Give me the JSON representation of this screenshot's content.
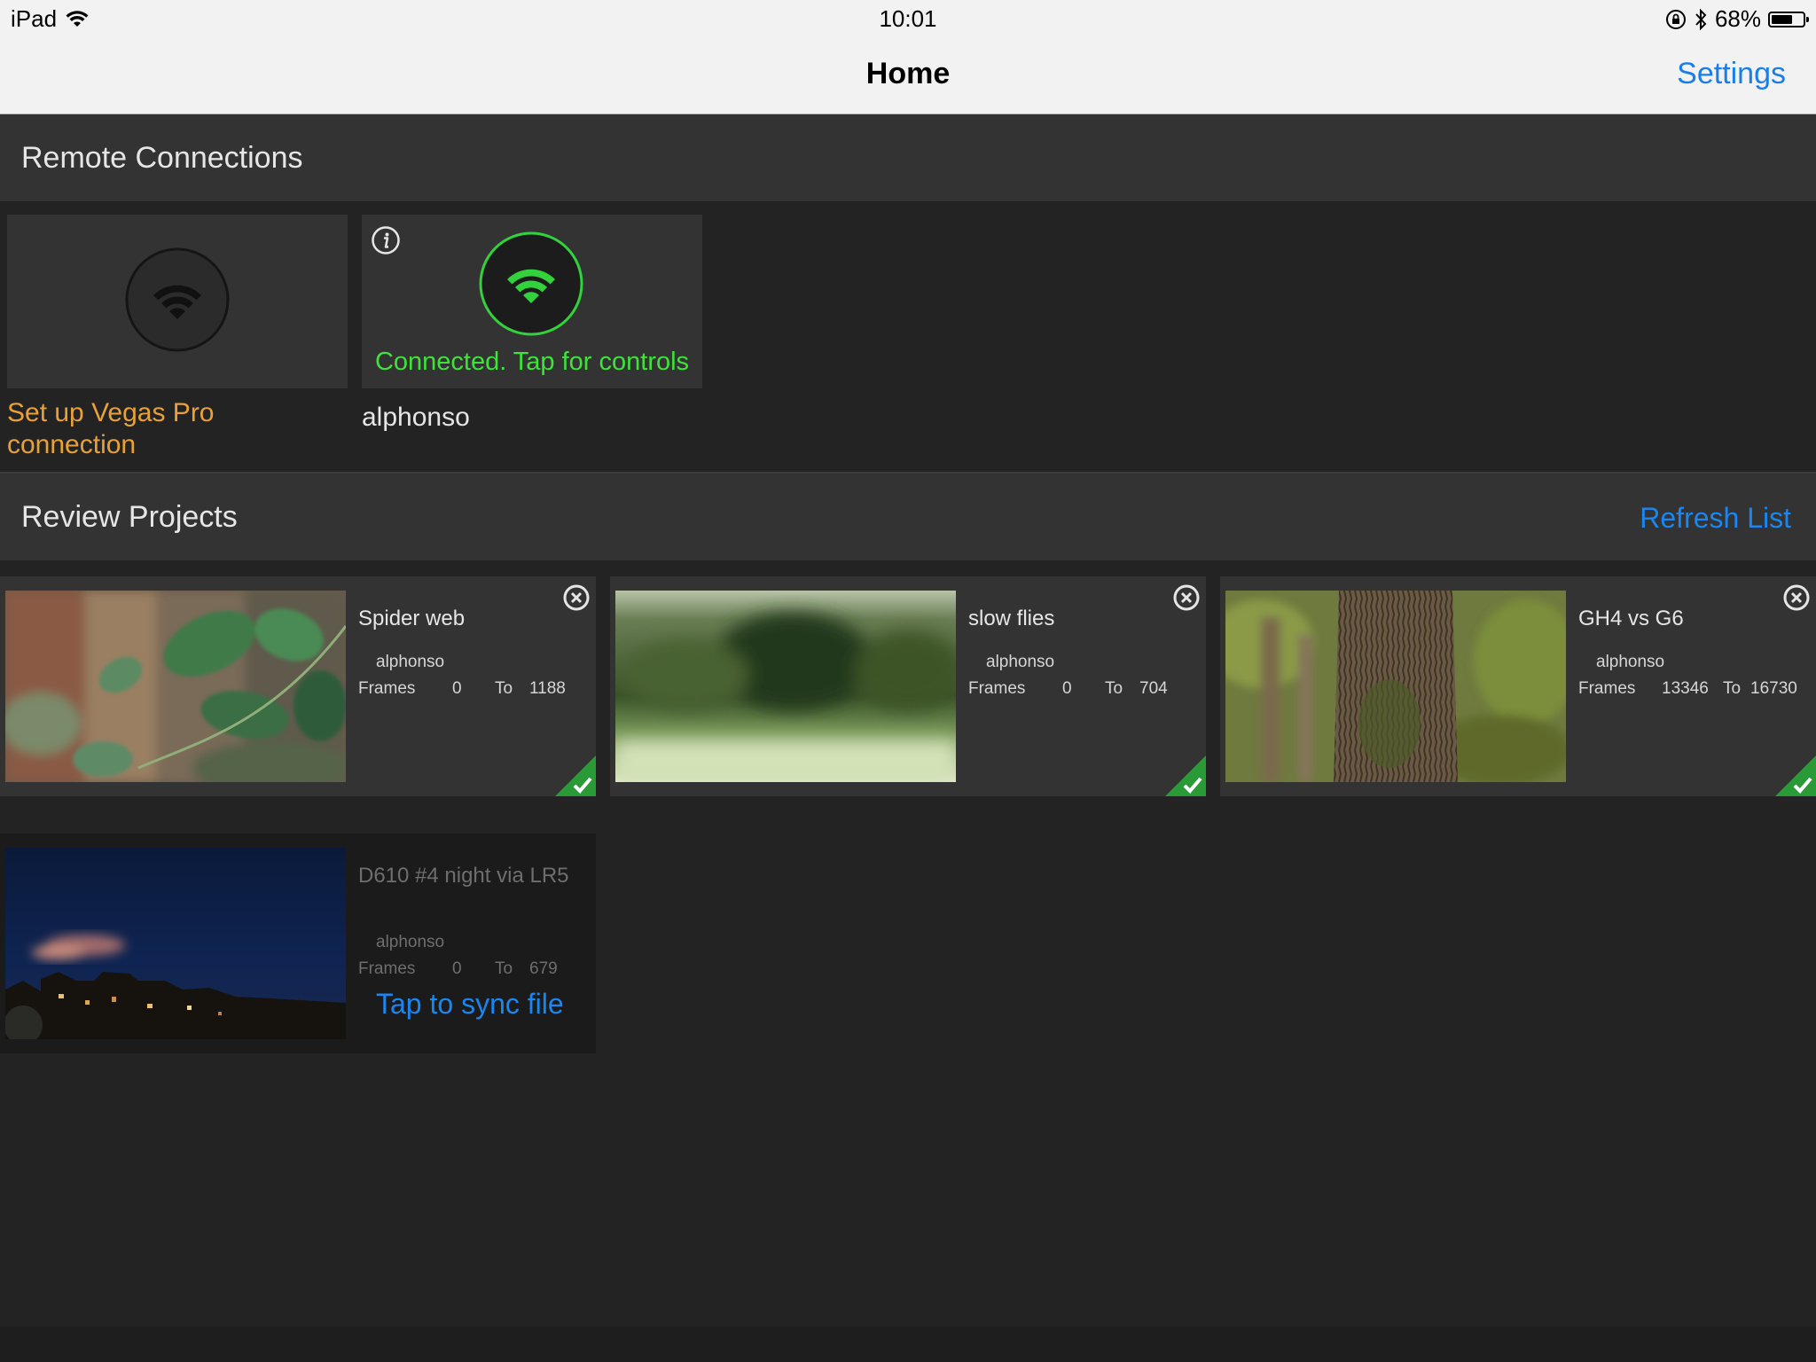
{
  "status_bar": {
    "device": "iPad",
    "time": "10:01",
    "battery": "68%",
    "battery_level": 0.68
  },
  "nav": {
    "title": "Home",
    "settings": "Settings"
  },
  "remote_connections": {
    "header": "Remote Connections",
    "setup_label": "Set up Vegas Pro connection",
    "connected_status": "Connected. Tap for controls",
    "connection_name": "alphonso"
  },
  "review_projects": {
    "header": "Review Projects",
    "refresh": "Refresh List",
    "frames_label": "Frames",
    "to_label": "To",
    "sync_label": "Tap to sync file",
    "projects": [
      {
        "title": "Spider web",
        "owner": "alphonso",
        "from": "0",
        "to": "1188"
      },
      {
        "title": "slow flies",
        "owner": "alphonso",
        "from": "0",
        "to": "704"
      },
      {
        "title": "GH4 vs G6",
        "owner": "alphonso",
        "from": "13346",
        "to": "16730"
      },
      {
        "title": "D610 #4 night via LR5",
        "owner": "alphonso",
        "from": "0",
        "to": "679"
      }
    ]
  },
  "colors": {
    "accent_blue": "#1a86f0",
    "connected_green": "#3ee23a",
    "setup_orange": "#e8a13a"
  }
}
